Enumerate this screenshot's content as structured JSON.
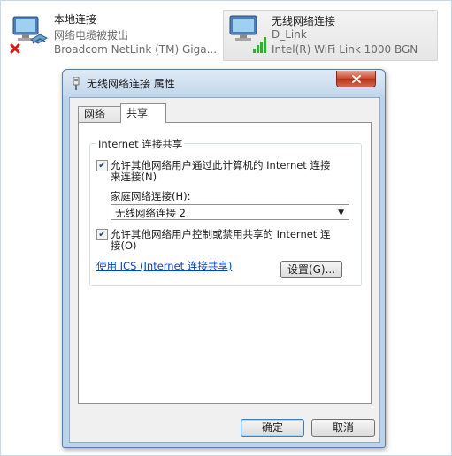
{
  "adapters": {
    "local": {
      "name": "本地连接",
      "status": "网络电缆被拔出",
      "device": "Broadcom NetLink (TM) Giga..."
    },
    "wifi": {
      "name": "无线网络连接",
      "status": "D_Link",
      "device": "Intel(R) WiFi Link 1000 BGN"
    }
  },
  "dialog": {
    "title": "无线网络连接 属性",
    "tabs": [
      {
        "label": "网络"
      },
      {
        "label": "共享"
      }
    ],
    "group_title": "Internet 连接共享",
    "option_allow_connect": {
      "checked": true,
      "line1": "允许其他网络用户通过此计算机的 Internet 连接",
      "line2": "来连接(N)"
    },
    "home_network_label": "家庭网络连接(H):",
    "home_network_select": {
      "value": "无线网络连接 2"
    },
    "option_allow_control": {
      "checked": true,
      "line1": "允许其他网络用户控制或禁用共享的 Internet 连",
      "line2": "接(O)"
    },
    "ics_link": "使用 ICS (Internet 连接共享)",
    "settings_button": "设置(G)...",
    "ok_button": "确定",
    "cancel_button": "取消"
  },
  "colors": {
    "dialog_frame": "#bcd4ea",
    "close_button": "#c8472f",
    "link": "#0044cc"
  }
}
